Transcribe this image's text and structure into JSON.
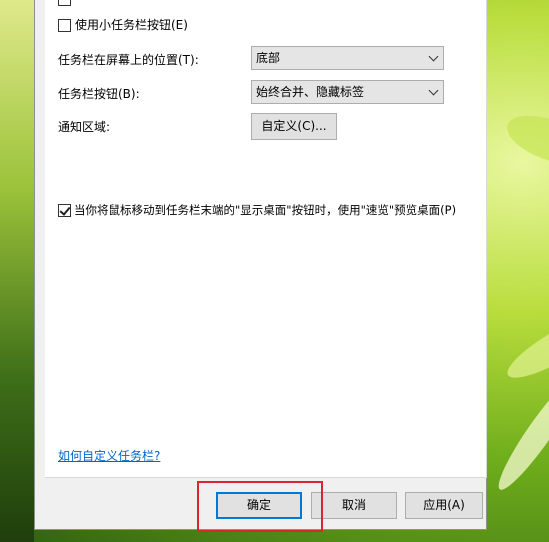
{
  "settings": {
    "small_buttons_label": "使用小任务栏按钮(E)",
    "small_buttons_checked": false,
    "position_label": "任务栏在屏幕上的位置(T):",
    "position_value": "底部",
    "buttons_label": "任务栏按钮(B):",
    "buttons_value": "始终合并、隐藏标签",
    "notification_label": "通知区域:",
    "customize_button": "自定义(C)...",
    "peek_label": "当你将鼠标移动到任务栏末端的\"显示桌面\"按钮时，使用\"速览\"预览桌面(P)",
    "peek_checked": true,
    "help_link": "如何自定义任务栏?"
  },
  "footer": {
    "ok": "确定",
    "cancel": "取消",
    "apply": "应用(A)"
  },
  "colors": {
    "highlight": "#d9262f",
    "link": "#0066cc",
    "focus": "#0078d7"
  }
}
